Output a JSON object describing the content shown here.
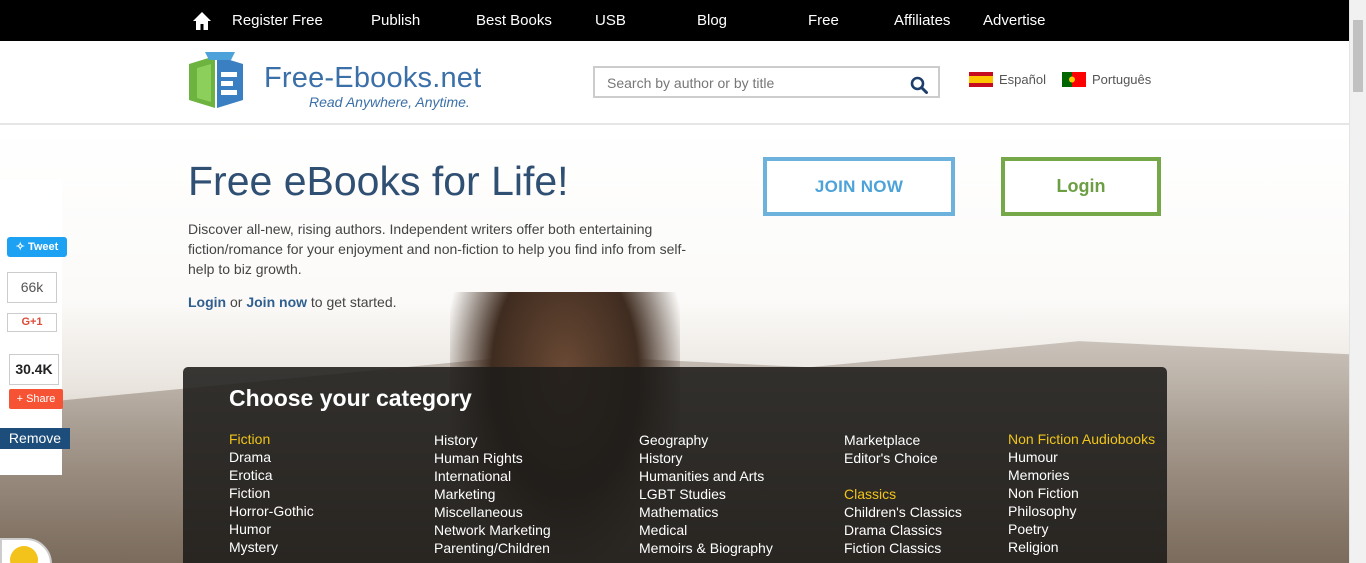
{
  "topnav": {
    "items": [
      "Register Free",
      "Publish",
      "Best Books",
      "USB",
      "Blog",
      "Free",
      "Affiliates",
      "Advertise"
    ]
  },
  "header": {
    "logo_title": "Free-Ebooks.net",
    "logo_tagline": "Read Anywhere, Anytime.",
    "search_placeholder": "Search by author or by title",
    "languages": [
      "Español",
      "Português"
    ]
  },
  "hero": {
    "title": "Free eBooks for Life!",
    "description": "Discover all-new, rising authors. Independent writers offer both entertaining fiction/romance for your enjoyment and non-fiction to help you find info from self-help to biz growth.",
    "cta_login": "Login",
    "cta_or": "or",
    "cta_join": "Join now",
    "cta_suffix": "to get started.",
    "join_button": "JOIN NOW",
    "login_button": "Login"
  },
  "categories": {
    "title": "Choose your category",
    "col1": {
      "heading": "Fiction",
      "items": [
        "Drama",
        "Erotica",
        "Fiction",
        "Horror-Gothic",
        "Humor",
        "Mystery"
      ]
    },
    "col2": {
      "items": [
        "History",
        "Human Rights",
        "International",
        "Marketing",
        "Miscellaneous",
        "Network Marketing",
        "Parenting/Children"
      ]
    },
    "col3": {
      "items": [
        "Geography",
        "History",
        "Humanities and Arts",
        "LGBT Studies",
        "Mathematics",
        "Medical",
        "Memoirs & Biography"
      ]
    },
    "col4": {
      "items": [
        "Marketplace",
        "Editor's Choice"
      ],
      "heading2": "Classics",
      "items2": [
        "Children's Classics",
        "Drama Classics",
        "Fiction Classics"
      ]
    },
    "col5": {
      "heading": "Non Fiction Audiobooks",
      "items": [
        "Humour",
        "Memories",
        "Non Fiction",
        "Philosophy",
        "Poetry",
        "Religion"
      ]
    }
  },
  "social": {
    "tweet": "Tweet",
    "plus_count": "66k",
    "gplus": "G+1",
    "share_count": "30.4K",
    "share": "Share",
    "remove": "Remove"
  },
  "colors": {
    "brand_blue": "#3a6fa8",
    "join_blue": "#6cb2dd",
    "login_green": "#76a84a",
    "category_heading": "#f0c419"
  }
}
